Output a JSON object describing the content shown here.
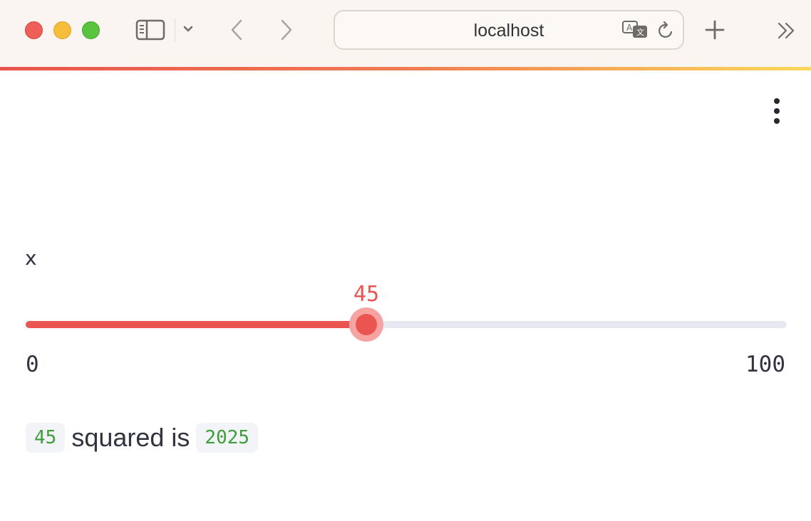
{
  "browser": {
    "url": "localhost",
    "icons": [
      "sidebar-icon",
      "chevron-down-icon",
      "back-icon",
      "forward-icon",
      "translate-icon",
      "reload-icon",
      "new-tab-icon",
      "more-tabs-icon"
    ]
  },
  "app": {
    "menu_icon": "vertical-ellipsis-icon",
    "slider": {
      "label": "x",
      "value": 45,
      "value_text": "45",
      "min": 0,
      "max": 100,
      "min_text": "0",
      "max_text": "100",
      "accent_color": "#ea5551"
    },
    "result": {
      "input": "45",
      "text": "squared is",
      "output": "2025",
      "code_color": "#3e9c3b"
    }
  }
}
